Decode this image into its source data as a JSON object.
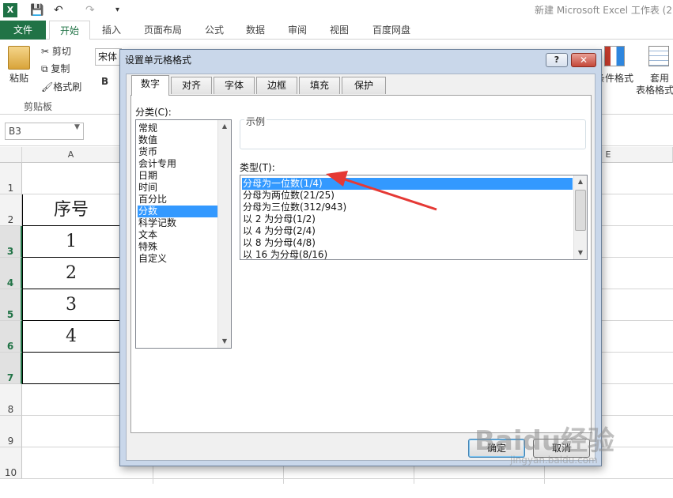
{
  "app": {
    "window_title": "新建 Microsoft Excel 工作表 (2",
    "icon_glyph": "X"
  },
  "qat": {
    "save": "💾",
    "undo": "↶",
    "redo": "↷",
    "more": "▾"
  },
  "ribbon_tabs": [
    "文件",
    "开始",
    "插入",
    "页面布局",
    "公式",
    "数据",
    "审阅",
    "视图",
    "百度网盘"
  ],
  "ribbon": {
    "paste": "粘贴",
    "cut": "剪切",
    "copy": "复制",
    "format_painter": "格式刷",
    "clipboard_group": "剪贴板",
    "font_name": "宋体",
    "bold": "B",
    "conditional_format": "条件格式",
    "table_format_1": "套用",
    "table_format_2": "表格格式"
  },
  "namebox": {
    "value": "B3"
  },
  "grid": {
    "col_headers": [
      "A",
      "E"
    ],
    "row_headers": [
      "1",
      "2",
      "3",
      "4",
      "5",
      "6",
      "7",
      "8",
      "9",
      "10"
    ],
    "cells_A": [
      "",
      "序号",
      "1",
      "2",
      "3",
      "4",
      ""
    ]
  },
  "dialog": {
    "title": "设置单元格格式",
    "help": "?",
    "close": "✕",
    "tabs": [
      "数字",
      "对齐",
      "字体",
      "边框",
      "填充",
      "保护"
    ],
    "active_tab": "数字",
    "category_label": "分类(C):",
    "categories": [
      "常规",
      "数值",
      "货币",
      "会计专用",
      "日期",
      "时间",
      "百分比",
      "分数",
      "科学记数",
      "文本",
      "特殊",
      "自定义"
    ],
    "selected_category": "分数",
    "sample_label": "示例",
    "type_label": "类型(T):",
    "types": [
      "分母为一位数(1/4)",
      "分母为两位数(21/25)",
      "分母为三位数(312/943)",
      "以 2 为分母(1/2)",
      "以 4 为分母(2/4)",
      "以 8 为分母(4/8)",
      "以 16 为分母(8/16)"
    ],
    "selected_type": "分母为一位数(1/4)",
    "ok": "确定",
    "cancel": "取消"
  },
  "watermark": {
    "brand": "Baidu经验",
    "url": "jingyan.baidu.com"
  },
  "colors": {
    "excel_green": "#217346",
    "selection_blue": "#3399ff",
    "arrow_red": "#e53935"
  }
}
